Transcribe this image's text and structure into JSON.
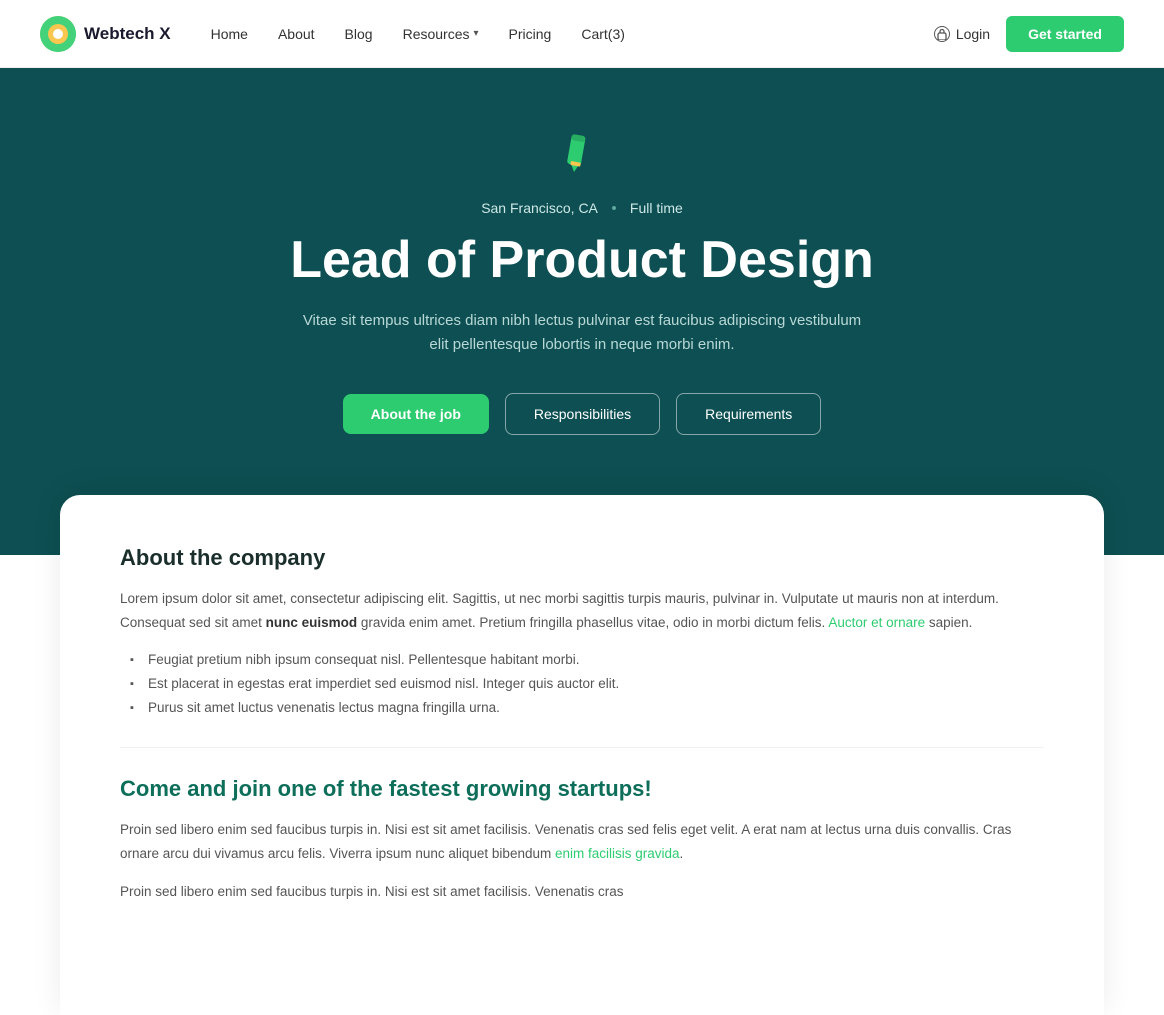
{
  "navbar": {
    "logo_text": "Webtech X",
    "links": [
      {
        "label": "Home",
        "has_dropdown": false
      },
      {
        "label": "About",
        "has_dropdown": false
      },
      {
        "label": "Blog",
        "has_dropdown": false
      },
      {
        "label": "Resources",
        "has_dropdown": true
      },
      {
        "label": "Pricing",
        "has_dropdown": false
      },
      {
        "label": "Cart(3)",
        "has_dropdown": false
      }
    ],
    "login_label": "Login",
    "get_started_label": "Get started"
  },
  "hero": {
    "location": "San Francisco, CA",
    "job_type": "Full time",
    "title": "Lead of Product Design",
    "description": "Vitae sit tempus ultrices diam nibh lectus pulvinar est faucibus adipiscing vestibulum elit pellentesque lobortis in neque morbi enim.",
    "btn_about": "About the job",
    "btn_responsibilities": "Responsibilities",
    "btn_requirements": "Requirements"
  },
  "content": {
    "company_heading": "About the company",
    "company_paragraph1": "Lorem ipsum dolor sit amet, consectetur adipiscing elit. Sagittis, ut nec morbi sagittis turpis mauris, pulvinar in. Vulputate ut mauris non at interdum. Consequat sed sit amet ",
    "company_bold": "nunc euismod",
    "company_paragraph1b": " gravida enim amet. Pretium fringilla phasellus vitae, odio in morbi dictum felis. ",
    "company_link1": "Auctor et ornare",
    "company_paragraph1c": " sapien.",
    "bullet_items": [
      "Feugiat pretium nibh ipsum consequat nisl. Pellentesque habitant morbi.",
      "Est placerat in egestas erat imperdiet sed euismod nisl. Integer quis auctor elit.",
      "Purus sit amet luctus venenatis lectus magna fringilla urna."
    ],
    "startup_heading": "Come and join one of the fastest growing startups!",
    "startup_paragraph1": "Proin sed libero enim sed faucibus turpis in. Nisi est sit amet facilisis. Venenatis cras sed felis eget velit. A erat nam at lectus urna duis convallis. Cras ornare arcu dui vivamus arcu felis. Viverra ipsum nunc aliquet bibendum ",
    "startup_link1": "enim facilisis gravida",
    "startup_paragraph1b": ".",
    "startup_paragraph2": "Proin sed libero enim sed faucibus turpis in. Nisi est sit amet facilisis. Venenatis cras"
  }
}
